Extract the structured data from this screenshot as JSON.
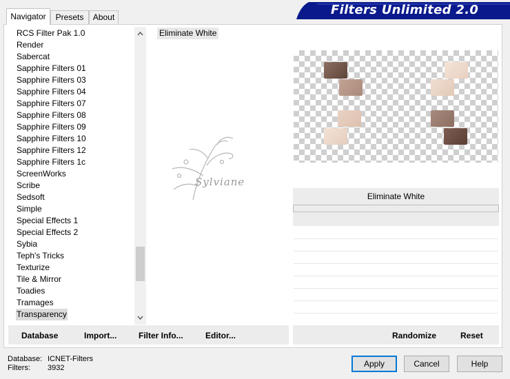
{
  "title": "Filters Unlimited 2.0",
  "tabs": [
    "Navigator",
    "Presets",
    "About"
  ],
  "categories": [
    "RCS Filter Pak 1.0",
    "Render",
    "Sabercat",
    "Sapphire Filters 01",
    "Sapphire Filters 03",
    "Sapphire Filters 04",
    "Sapphire Filters 07",
    "Sapphire Filters 08",
    "Sapphire Filters 09",
    "Sapphire Filters 10",
    "Sapphire Filters 12",
    "Sapphire Filters 1c",
    "ScreenWorks",
    "Scribe",
    "Sedsoft",
    "Simple",
    "Special Effects 1",
    "Special Effects 2",
    "Sybia",
    "Teph's Tricks",
    "Texturize",
    "Tile & Mirror",
    "Toadies",
    "Tramages",
    "Transparency"
  ],
  "selected_category": "Transparency",
  "filters": [
    "Eliminate White"
  ],
  "params_title": "Eliminate White",
  "watermark": "Sylviane",
  "bottom_left": {
    "database": "Database",
    "import": "Import...",
    "filter_info": "Filter Info...",
    "editor": "Editor..."
  },
  "bottom_right": {
    "randomize": "Randomize",
    "reset": "Reset"
  },
  "status": {
    "database_label": "Database:",
    "database_value": "ICNET-Filters",
    "filters_label": "Filters:",
    "filters_value": "3932"
  },
  "buttons": {
    "apply": "Apply",
    "cancel": "Cancel",
    "help": "Help"
  },
  "colors": {
    "banner": "#0a1a8c",
    "accent": "#0078d7"
  }
}
